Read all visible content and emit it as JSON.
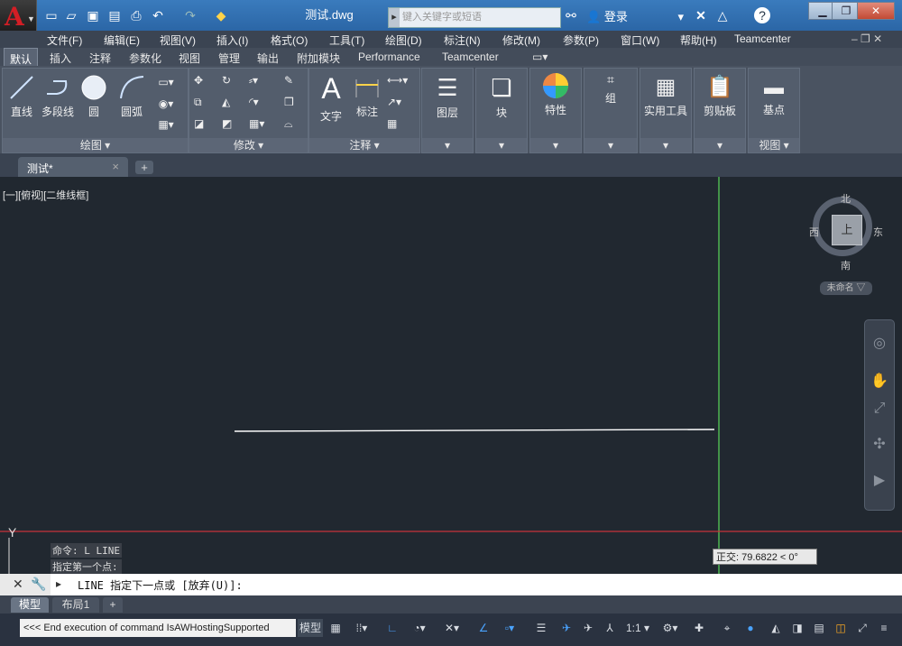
{
  "title_bar": {
    "document_title": "测试.dwg",
    "search_placeholder": "键入关键字或短语",
    "login_label": "登录",
    "help_label": "?"
  },
  "menu": [
    "文件(F)",
    "编辑(E)",
    "视图(V)",
    "插入(I)",
    "格式(O)",
    "工具(T)",
    "绘图(D)",
    "标注(N)",
    "修改(M)",
    "参数(P)",
    "窗口(W)",
    "帮助(H)",
    "Teamcenter"
  ],
  "ribbon_tabs": [
    "默认",
    "插入",
    "注释",
    "参数化",
    "视图",
    "管理",
    "输出",
    "附加模块",
    "Performance",
    "Teamcenter"
  ],
  "ribbon": {
    "draw": {
      "line": "直线",
      "polyline": "多段线",
      "circle": "圆",
      "arc": "圆弧",
      "title": "绘图 ▾"
    },
    "modify": {
      "title": "修改 ▾"
    },
    "annotation": {
      "text": "文字",
      "dimension": "标注",
      "title": "注释 ▾"
    },
    "layers": {
      "label": "图层"
    },
    "block": {
      "label": "块"
    },
    "properties": {
      "label": "特性"
    },
    "groups": {
      "label": "组"
    },
    "utilities": {
      "label": "实用工具"
    },
    "clipboard": {
      "label": "剪贴板"
    },
    "view": {
      "basepoint": "基点",
      "title": "视图 ▾"
    }
  },
  "file_tab": {
    "name": "测试*",
    "close": "×",
    "add": "+"
  },
  "viewport": {
    "label": "[一][俯视][二维线框]"
  },
  "viewcube": {
    "north": "北",
    "south": "南",
    "west": "西",
    "east": "东",
    "top": "上",
    "ucs": "未命名 ▽"
  },
  "axis_label": "Y",
  "command": {
    "history": [
      "命令: L LINE",
      "指定第一个点:"
    ],
    "prompt": "LINE 指定下一点或 [放弃(U)]:"
  },
  "tooltip": {
    "text": "正交: 79.6822 < 0°"
  },
  "layout_tabs": [
    "模型",
    "布局1",
    "+"
  ],
  "status": {
    "message": "<<< End execution of command IsAWHostingSupported",
    "model": "模型",
    "scale": "1:1 ▾"
  },
  "colors": {
    "background": "#212830",
    "crosshair_v": "#5ad85a",
    "crosshair_h": "#c8323a",
    "line": "#ffffff",
    "accent": "#4aa3ff"
  }
}
